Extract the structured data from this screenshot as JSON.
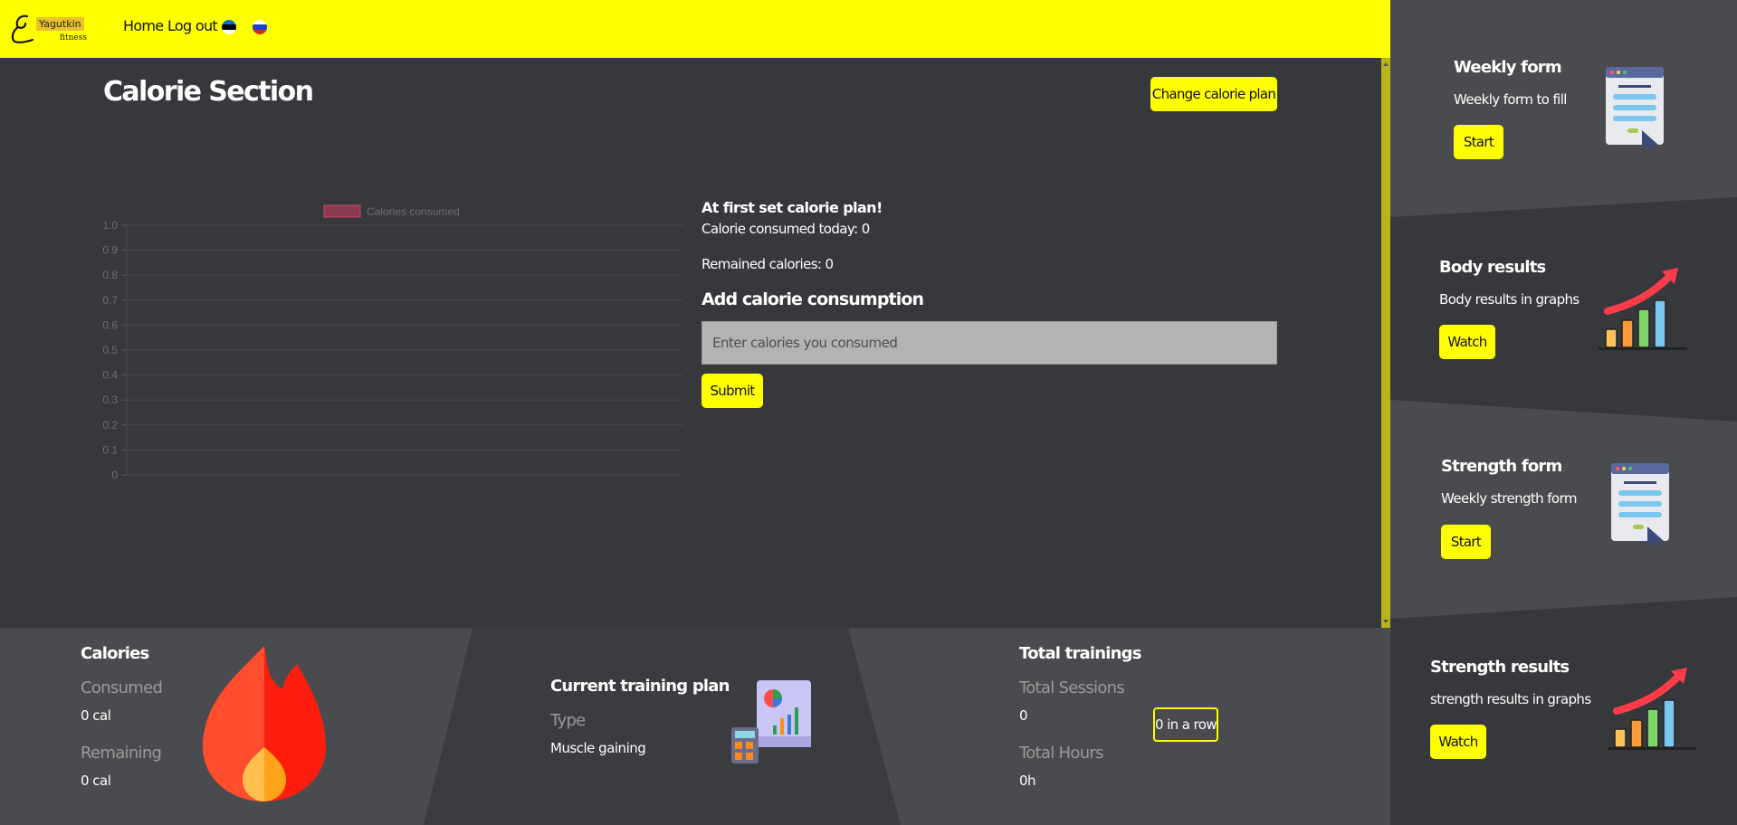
{
  "navbar": {
    "logo_text": "Yagutkin",
    "logo_sub": "fitness",
    "links": [
      "Home",
      "Log out"
    ],
    "flags": [
      "estonian-flag-icon",
      "russian-flag-icon"
    ]
  },
  "colors": {
    "accent": "#ffff00",
    "background": "#36383c",
    "panel": "#4a4b4e",
    "chart_bar": "#8b3a4f"
  },
  "calorie": {
    "title": "Calorie Section",
    "change_plan_label": "Change calorie plan",
    "set_plan_msg": "At first set calorie plan!",
    "consumed_today_label": "Calorie consumed today: 0",
    "remained_label": "Remained calories: 0",
    "add_heading": "Add calorie consumption",
    "input_placeholder": "Enter calories you consumed",
    "submit_label": "Submit"
  },
  "chart_data": {
    "type": "bar",
    "legend": [
      "Calories consumed"
    ],
    "series": [
      {
        "name": "Calories consumed",
        "values": []
      }
    ],
    "categories": [],
    "y_ticks": [
      "1.0",
      "0.9",
      "0.8",
      "0.7",
      "0.6",
      "0.5",
      "0.4",
      "0.3",
      "0.2",
      "0.1",
      "0"
    ],
    "ylim": [
      0,
      1
    ],
    "grid": true,
    "legend_position": "top"
  },
  "stats": {
    "calories": {
      "title": "Calories",
      "consumed_label": "Consumed",
      "consumed_value": "0 cal",
      "remaining_label": "Remaining",
      "remaining_value": "0 cal"
    },
    "training_plan": {
      "title": "Current training plan",
      "type_label": "Type",
      "type_value": "Muscle gaining"
    },
    "trainings": {
      "title": "Total trainings",
      "sessions_label": "Total Sessions",
      "sessions_value": "0",
      "hours_label": "Total Hours",
      "hours_value": "0h",
      "streak": "0 in a row"
    }
  },
  "sidebar": {
    "cards": [
      {
        "title": "Weekly form",
        "desc": "Weekly form to fill",
        "button": "Start"
      },
      {
        "title": "Body results",
        "desc": "Body results in graphs",
        "button": "Watch"
      },
      {
        "title": "Strength form",
        "desc": "Weekly strength form",
        "button": "Start"
      },
      {
        "title": "Strength results",
        "desc": "strength results in graphs",
        "button": "Watch"
      }
    ]
  }
}
